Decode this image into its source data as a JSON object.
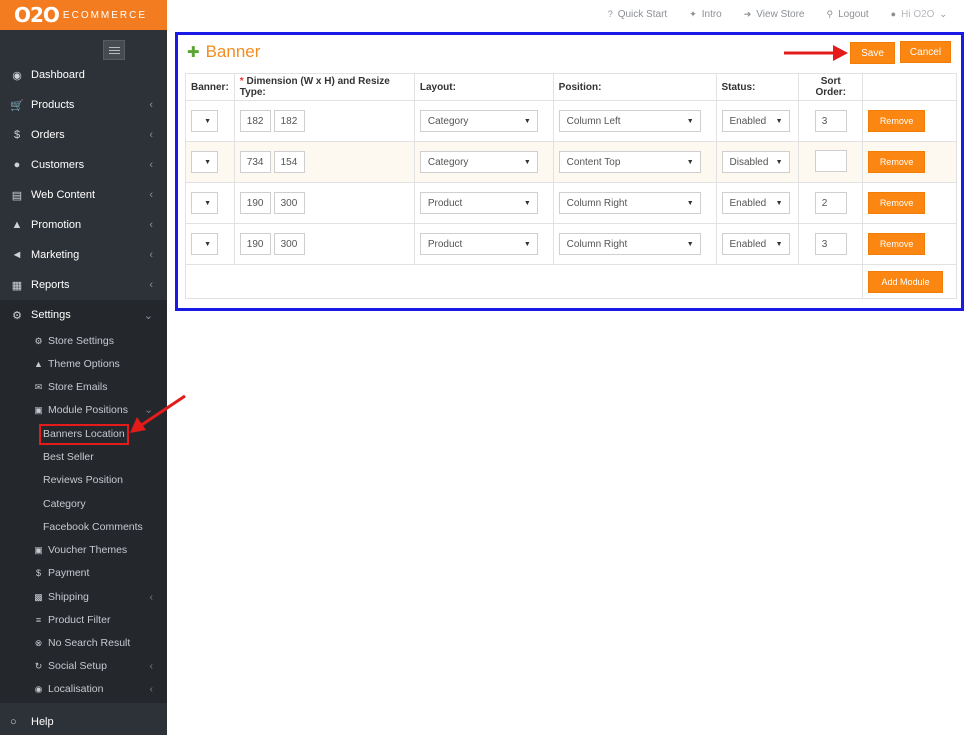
{
  "logo": {
    "big": "O2O",
    "small": "ECOMMERCE"
  },
  "topbar": {
    "quick_start": "Quick Start",
    "intro": "Intro",
    "view_store": "View Store",
    "logout": "Logout",
    "user": "Hi O2O"
  },
  "sidebar": {
    "items": [
      {
        "label": "Dashboard",
        "icon": "dashboard-icon"
      },
      {
        "label": "Products",
        "icon": "cart-icon"
      },
      {
        "label": "Orders",
        "icon": "dollar-icon"
      },
      {
        "label": "Customers",
        "icon": "user-icon"
      },
      {
        "label": "Web Content",
        "icon": "book-icon"
      },
      {
        "label": "Promotion",
        "icon": "thumbs-up-icon"
      },
      {
        "label": "Marketing",
        "icon": "bullhorn-icon"
      },
      {
        "label": "Reports",
        "icon": "bar-chart-icon"
      },
      {
        "label": "Settings",
        "icon": "cogs-icon"
      }
    ],
    "settings_sub": [
      {
        "label": "Store Settings"
      },
      {
        "label": "Theme Options"
      },
      {
        "label": "Store Emails"
      },
      {
        "label": "Module Positions"
      }
    ],
    "module_sub": [
      {
        "label": "Banners Location"
      },
      {
        "label": "Best Seller"
      },
      {
        "label": "Reviews Position"
      },
      {
        "label": "Category"
      },
      {
        "label": "Facebook Comments"
      }
    ],
    "settings_sub2": [
      {
        "label": "Voucher Themes"
      },
      {
        "label": "Payment"
      },
      {
        "label": "Shipping"
      },
      {
        "label": "Product Filter"
      },
      {
        "label": "No Search Result"
      },
      {
        "label": "Social Setup"
      },
      {
        "label": "Localisation"
      }
    ],
    "help": "Help"
  },
  "panel": {
    "title": "Banner",
    "save_label": "Save",
    "cancel_label": "Cancel",
    "columns": {
      "banner": "Banner:",
      "required_mark": "*",
      "dimension": "Dimension (W x H) and Resize Type:",
      "layout": "Layout:",
      "position": "Position:",
      "status": "Status:",
      "sort": "Sort Order:"
    },
    "rows": [
      {
        "width": "182",
        "height": "182",
        "layout": "Category",
        "position": "Column Left",
        "status": "Enabled",
        "sort": "3"
      },
      {
        "width": "734",
        "height": "154",
        "layout": "Category",
        "position": "Content Top",
        "status": "Disabled",
        "sort": ""
      },
      {
        "width": "190",
        "height": "300",
        "layout": "Product",
        "position": "Column Right",
        "status": "Enabled",
        "sort": "2"
      },
      {
        "width": "190",
        "height": "300",
        "layout": "Product",
        "position": "Column Right",
        "status": "Enabled",
        "sort": "3"
      }
    ],
    "remove_label": "Remove",
    "add_module_label": "Add Module"
  },
  "colors": {
    "accent": "#fb8612",
    "sidebar_bg": "#2d3238",
    "highlight_border": "#1a1ae6",
    "annotation": "#e41b1b"
  }
}
